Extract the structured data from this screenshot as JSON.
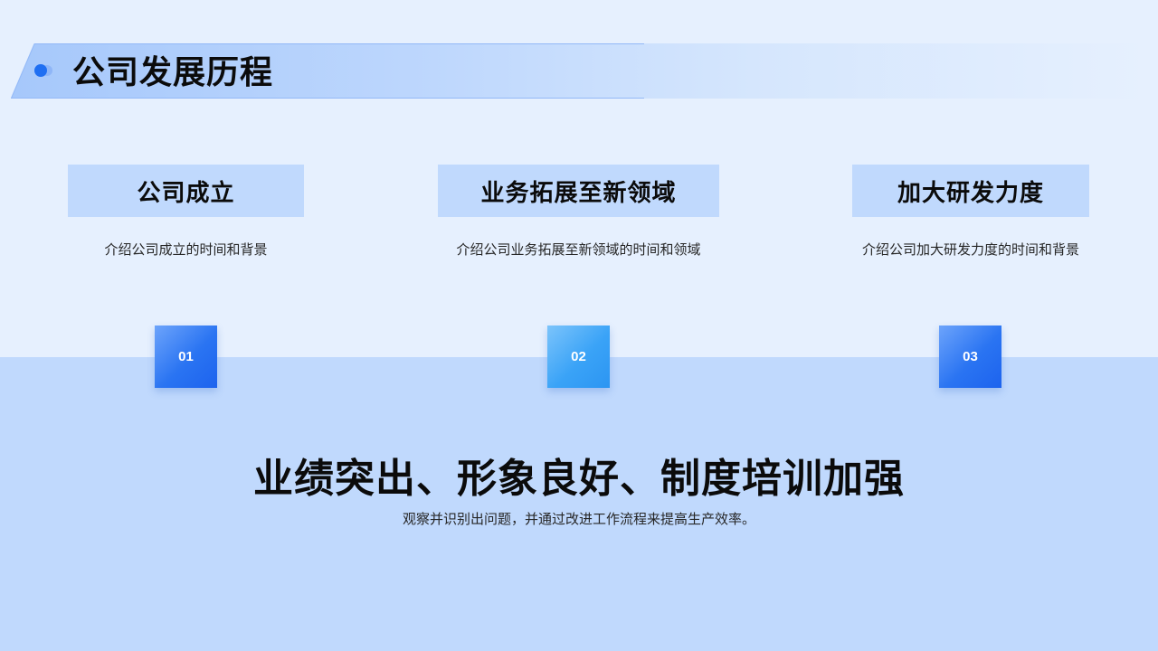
{
  "slide": {
    "title": "公司发展历程",
    "colors": {
      "top_background": "#e6f0fe",
      "bottom_background": "#c0d9fd",
      "header_box": "#c0d9fd",
      "accent_blue": "#1f6ff2",
      "accent_cyan": "#3aa3f7",
      "title_text": "#0b0b0b"
    },
    "icons": {
      "title_decoration": "double-dot-icon"
    }
  },
  "milestones": [
    {
      "number": "01",
      "title": "公司成立",
      "description": "介绍公司成立的时间和背景",
      "box_color": "blue"
    },
    {
      "number": "02",
      "title": "业务拓展至新领域",
      "description": "介绍公司业务拓展至新领域的时间和领域",
      "box_color": "cyan"
    },
    {
      "number": "03",
      "title": "加大研发力度",
      "description": "介绍公司加大研发力度的时间和背景",
      "box_color": "blue"
    }
  ],
  "summary": {
    "headline": "业绩突出、形象良好、制度培训加强",
    "subtext": "观察并识别出问题，并通过改进工作流程来提高生产效率。"
  }
}
